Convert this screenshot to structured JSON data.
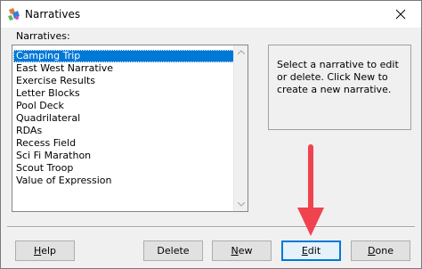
{
  "window": {
    "title": "Narratives",
    "close_label": "×"
  },
  "list": {
    "label": "Narratives:",
    "items": [
      "Camping Trip",
      "East West Narrative",
      "Exercise Results",
      "Letter Blocks",
      "Pool Deck",
      "Quadrilateral",
      "RDAs",
      "Recess Field",
      "Sci Fi Marathon",
      "Scout Troop",
      "Value of Expression"
    ],
    "selected_index": 0
  },
  "help_text": "Select a narrative to edit or delete.  Click New to create a new narrative.",
  "buttons": {
    "help": {
      "mnemonic": "H",
      "rest": "elp"
    },
    "delete": {
      "label": "Delete"
    },
    "new": {
      "mnemonic": "N",
      "rest": "ew"
    },
    "edit": {
      "mnemonic": "E",
      "rest": "dit"
    },
    "done": {
      "mnemonic": "D",
      "rest": "one"
    }
  },
  "colors": {
    "selection": "#0078d7",
    "annotation_arrow": "#f0434f",
    "default_button_border": "#0078d7"
  },
  "icons": {
    "app": "narratives-app-icon",
    "close": "close-icon",
    "scroll_up": "scroll-up-arrow-icon",
    "scroll_down": "scroll-down-arrow-icon",
    "annotation": "red-down-arrow-icon"
  }
}
